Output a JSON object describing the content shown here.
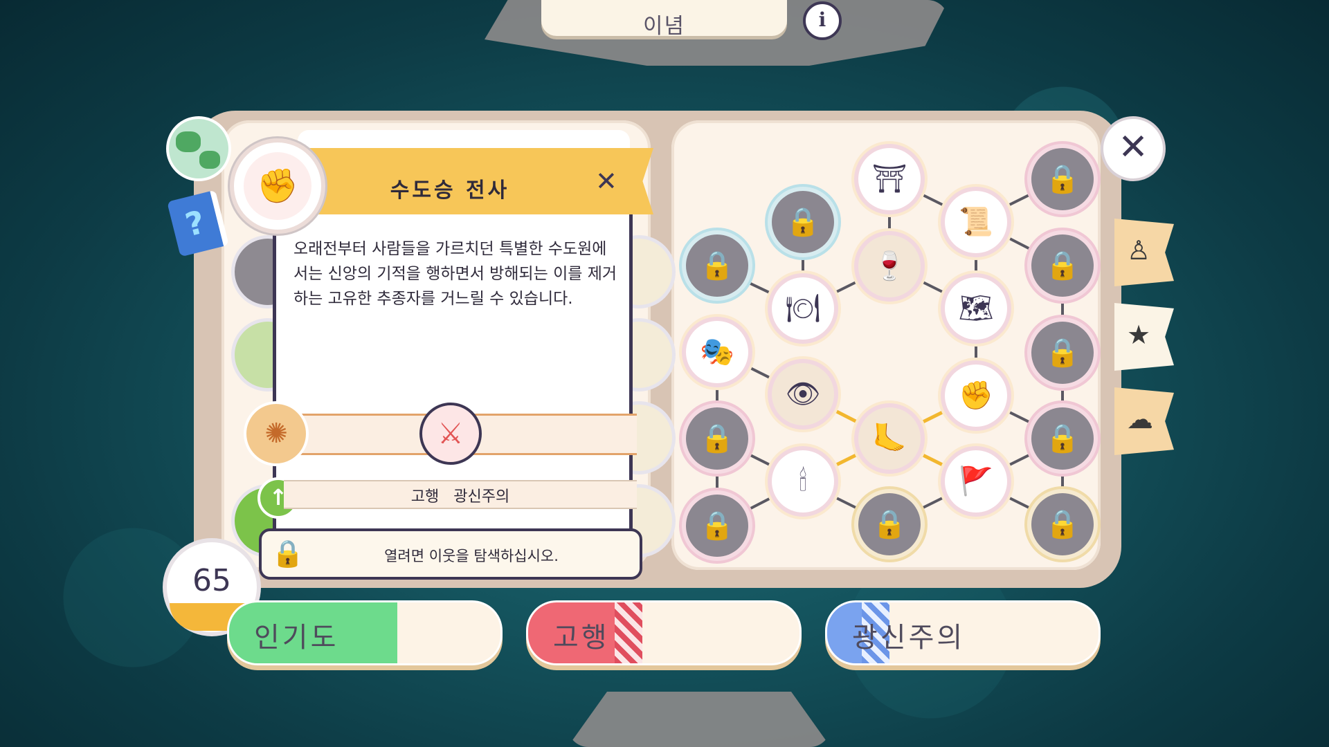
{
  "header": {
    "title": "이념",
    "info_icon": "info-icon"
  },
  "detail": {
    "title": "수도승 전사",
    "description": "오래전부터 사람들을 가르치던 특별한 수도원에서는 신앙의 기적을 행하면서 방해되는 이를 제거하는 고유한 추종자를 거느릴 수 있습니다.",
    "requirements": "고행 광신주의",
    "unlock_hint": "열려면 이웃을 탐색하십시오.",
    "close_symbol": "✕"
  },
  "counter": {
    "value": "65"
  },
  "stats": [
    {
      "label": "인기도",
      "level": 0.62,
      "color": "#6ddb8c",
      "style": "solid"
    },
    {
      "label": "고행",
      "level": 0.42,
      "color": "#ef6874",
      "style": "red"
    },
    {
      "label": "광신주의",
      "level": 0.23,
      "color": "#7aa3ef",
      "style": "blue"
    }
  ],
  "colors": {
    "accent": "#f7c658",
    "ink": "#3d3654",
    "page": "#fcf3e9"
  },
  "side_tabs": [
    "saint-icon",
    "star-icon",
    "weather-icon"
  ],
  "tree_nodes": [
    {
      "name": "locked-skill-node",
      "icon": "lock-icon",
      "state": "locked"
    },
    {
      "name": "crown-of-thorns-node",
      "icon": "lock-icon",
      "state": "locked"
    },
    {
      "name": "shrine-node",
      "icon": "shrine-icon",
      "state": "open"
    },
    {
      "name": "tablets-node",
      "icon": "tablets-icon",
      "state": "open"
    },
    {
      "name": "locked-top-right-node",
      "icon": "lock-icon",
      "state": "locked"
    },
    {
      "name": "chalice-bread-node",
      "icon": "chalice-icon",
      "state": "open"
    },
    {
      "name": "fasting-node",
      "icon": "plate-cross-icon",
      "state": "open"
    },
    {
      "name": "locked-book-node",
      "icon": "lock-icon",
      "state": "locked"
    },
    {
      "name": "map-star-node",
      "icon": "map-icon",
      "state": "open"
    },
    {
      "name": "mask-node",
      "icon": "mask-icon",
      "state": "open"
    },
    {
      "name": "all-seeing-eye-node",
      "icon": "eye-icon",
      "state": "open"
    },
    {
      "name": "locked-shield-node",
      "icon": "lock-icon",
      "state": "locked"
    },
    {
      "name": "fist-node",
      "icon": "fist-icon",
      "state": "open"
    },
    {
      "name": "pilgrim-foot-node",
      "icon": "foot-icon",
      "state": "open"
    },
    {
      "name": "locked-bowl-node",
      "icon": "lock-icon",
      "state": "locked"
    },
    {
      "name": "locked-wings-node",
      "icon": "lock-icon",
      "state": "locked"
    },
    {
      "name": "candle-node",
      "icon": "candle-icon",
      "state": "open"
    },
    {
      "name": "banner-node",
      "icon": "banner-icon",
      "state": "open"
    },
    {
      "name": "locked-skull-node",
      "icon": "lock-icon",
      "state": "locked"
    },
    {
      "name": "locked-statue-node",
      "icon": "lock-icon",
      "state": "locked"
    },
    {
      "name": "locked-sun-node",
      "icon": "lock-icon",
      "state": "locked"
    }
  ]
}
